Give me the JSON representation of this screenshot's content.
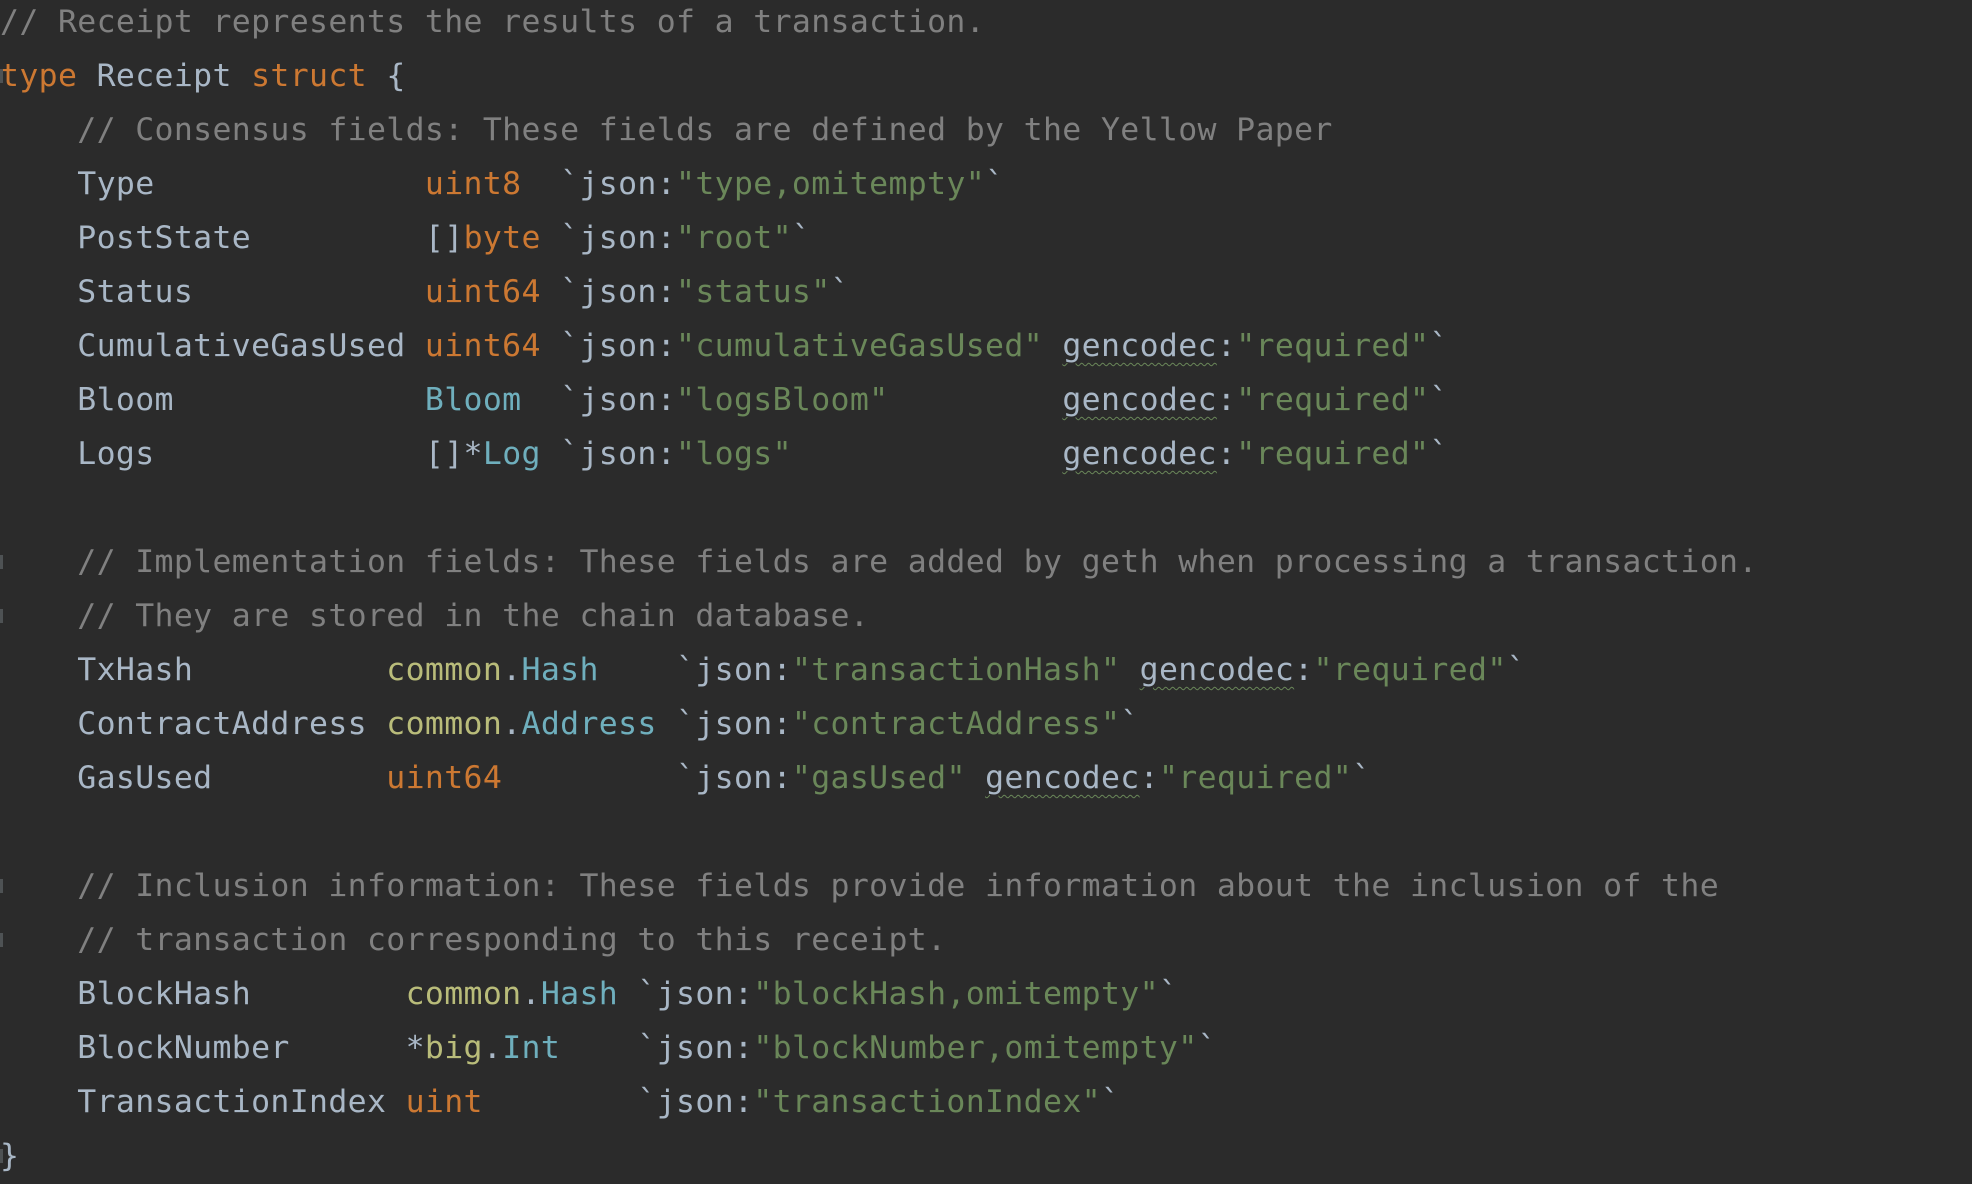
{
  "editor": {
    "language": "go",
    "colors": {
      "background": "#2b2b2b",
      "comment": "#808080",
      "keyword": "#cc7832",
      "string": "#6a8759",
      "identifier": "#a9b7c6",
      "typename": "#6fafbd",
      "package": "#b9bc7a"
    },
    "lines": [
      {
        "tokens": [
          {
            "t": "comment",
            "v": "// Receipt represents the results of a transaction."
          }
        ]
      },
      {
        "tokens": [
          {
            "t": "keyword",
            "v": "type"
          },
          {
            "t": "plain",
            "v": " Receipt "
          },
          {
            "t": "keyword",
            "v": "struct"
          },
          {
            "t": "plain",
            "v": " {"
          }
        ]
      },
      {
        "tokens": [
          {
            "t": "plain",
            "v": "    "
          },
          {
            "t": "comment",
            "v": "// Consensus fields: These fields are defined by the Yellow Paper"
          }
        ]
      },
      {
        "tokens": [
          {
            "t": "plain",
            "v": "    Type              "
          },
          {
            "t": "type",
            "v": "uint8"
          },
          {
            "t": "plain",
            "v": "  `json:"
          },
          {
            "t": "string",
            "v": "\"type,omitempty\""
          },
          {
            "t": "plain",
            "v": "`"
          }
        ]
      },
      {
        "tokens": [
          {
            "t": "plain",
            "v": "    PostState         []"
          },
          {
            "t": "type",
            "v": "byte"
          },
          {
            "t": "plain",
            "v": " `json:"
          },
          {
            "t": "string",
            "v": "\"root\""
          },
          {
            "t": "plain",
            "v": "`"
          }
        ]
      },
      {
        "tokens": [
          {
            "t": "plain",
            "v": "    Status            "
          },
          {
            "t": "type",
            "v": "uint64"
          },
          {
            "t": "plain",
            "v": " `json:"
          },
          {
            "t": "string",
            "v": "\"status\""
          },
          {
            "t": "plain",
            "v": "`"
          }
        ]
      },
      {
        "tokens": [
          {
            "t": "plain",
            "v": "    CumulativeGasUsed "
          },
          {
            "t": "type",
            "v": "uint64"
          },
          {
            "t": "plain",
            "v": " `json:"
          },
          {
            "t": "string",
            "v": "\"cumulativeGasUsed\""
          },
          {
            "t": "plain",
            "v": " "
          },
          {
            "t": "squiggle",
            "v": "gencodec"
          },
          {
            "t": "plain",
            "v": ":"
          },
          {
            "t": "string",
            "v": "\"required\""
          },
          {
            "t": "plain",
            "v": "`"
          }
        ]
      },
      {
        "tokens": [
          {
            "t": "plain",
            "v": "    Bloom             "
          },
          {
            "t": "typename",
            "v": "Bloom"
          },
          {
            "t": "plain",
            "v": "  `json:"
          },
          {
            "t": "string",
            "v": "\"logsBloom\""
          },
          {
            "t": "plain",
            "v": "         "
          },
          {
            "t": "squiggle",
            "v": "gencodec"
          },
          {
            "t": "plain",
            "v": ":"
          },
          {
            "t": "string",
            "v": "\"required\""
          },
          {
            "t": "plain",
            "v": "`"
          }
        ]
      },
      {
        "tokens": [
          {
            "t": "plain",
            "v": "    Logs              []*"
          },
          {
            "t": "typename",
            "v": "Log"
          },
          {
            "t": "plain",
            "v": " `json:"
          },
          {
            "t": "string",
            "v": "\"logs\""
          },
          {
            "t": "plain",
            "v": "              "
          },
          {
            "t": "squiggle",
            "v": "gencodec"
          },
          {
            "t": "plain",
            "v": ":"
          },
          {
            "t": "string",
            "v": "\"required\""
          },
          {
            "t": "plain",
            "v": "`"
          }
        ]
      },
      {
        "tokens": []
      },
      {
        "tokens": [
          {
            "t": "plain",
            "v": "    "
          },
          {
            "t": "comment",
            "v": "// Implementation fields: These fields are added by geth when processing a transaction."
          }
        ]
      },
      {
        "tokens": [
          {
            "t": "plain",
            "v": "    "
          },
          {
            "t": "comment",
            "v": "// They are stored in the chain database."
          }
        ]
      },
      {
        "tokens": [
          {
            "t": "plain",
            "v": "    TxHash          "
          },
          {
            "t": "pkg",
            "v": "common"
          },
          {
            "t": "plain",
            "v": "."
          },
          {
            "t": "typename",
            "v": "Hash"
          },
          {
            "t": "plain",
            "v": "    `json:"
          },
          {
            "t": "string",
            "v": "\"transactionHash\""
          },
          {
            "t": "plain",
            "v": " "
          },
          {
            "t": "squiggle",
            "v": "gencodec"
          },
          {
            "t": "plain",
            "v": ":"
          },
          {
            "t": "string",
            "v": "\"required\""
          },
          {
            "t": "plain",
            "v": "`"
          }
        ]
      },
      {
        "tokens": [
          {
            "t": "plain",
            "v": "    ContractAddress "
          },
          {
            "t": "pkg",
            "v": "common"
          },
          {
            "t": "plain",
            "v": "."
          },
          {
            "t": "typename",
            "v": "Address"
          },
          {
            "t": "plain",
            "v": " `json:"
          },
          {
            "t": "string",
            "v": "\"contractAddress\""
          },
          {
            "t": "plain",
            "v": "`"
          }
        ]
      },
      {
        "tokens": [
          {
            "t": "plain",
            "v": "    GasUsed         "
          },
          {
            "t": "type",
            "v": "uint64"
          },
          {
            "t": "plain",
            "v": "         `json:"
          },
          {
            "t": "string",
            "v": "\"gasUsed\""
          },
          {
            "t": "plain",
            "v": " "
          },
          {
            "t": "squiggle",
            "v": "gencodec"
          },
          {
            "t": "plain",
            "v": ":"
          },
          {
            "t": "string",
            "v": "\"required\""
          },
          {
            "t": "plain",
            "v": "`"
          }
        ]
      },
      {
        "tokens": []
      },
      {
        "tokens": [
          {
            "t": "plain",
            "v": "    "
          },
          {
            "t": "comment",
            "v": "// Inclusion information: These fields provide information about the inclusion of the"
          }
        ]
      },
      {
        "tokens": [
          {
            "t": "plain",
            "v": "    "
          },
          {
            "t": "comment",
            "v": "// transaction corresponding to this receipt."
          }
        ]
      },
      {
        "tokens": [
          {
            "t": "plain",
            "v": "    BlockHash        "
          },
          {
            "t": "pkg",
            "v": "common"
          },
          {
            "t": "plain",
            "v": "."
          },
          {
            "t": "typename",
            "v": "Hash"
          },
          {
            "t": "plain",
            "v": " `json:"
          },
          {
            "t": "string",
            "v": "\"blockHash,omitempty\""
          },
          {
            "t": "plain",
            "v": "`"
          }
        ]
      },
      {
        "tokens": [
          {
            "t": "plain",
            "v": "    BlockNumber      *"
          },
          {
            "t": "pkg",
            "v": "big"
          },
          {
            "t": "plain",
            "v": "."
          },
          {
            "t": "typename",
            "v": "Int"
          },
          {
            "t": "plain",
            "v": "    `json:"
          },
          {
            "t": "string",
            "v": "\"blockNumber,omitempty\""
          },
          {
            "t": "plain",
            "v": "`"
          }
        ]
      },
      {
        "tokens": [
          {
            "t": "plain",
            "v": "    TransactionIndex "
          },
          {
            "t": "type",
            "v": "uint"
          },
          {
            "t": "plain",
            "v": "        `json:"
          },
          {
            "t": "string",
            "v": "\"transactionIndex\""
          },
          {
            "t": "plain",
            "v": "`"
          }
        ]
      },
      {
        "tokens": [
          {
            "t": "plain",
            "v": "}"
          }
        ]
      }
    ]
  }
}
